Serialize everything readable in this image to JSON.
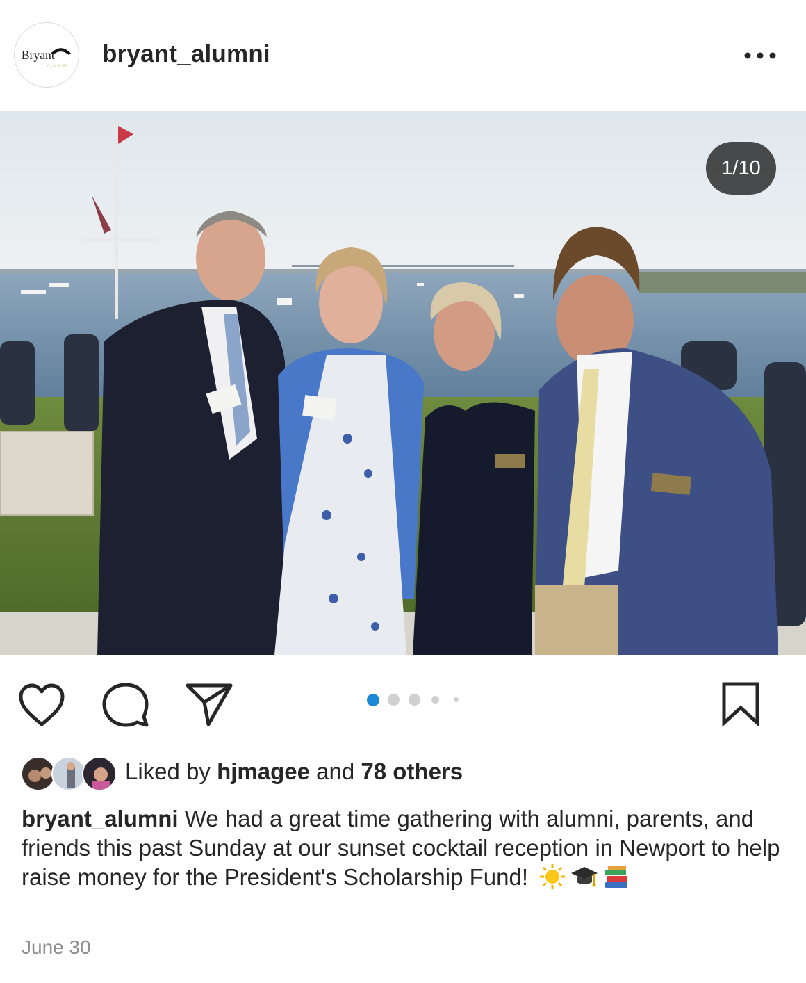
{
  "post": {
    "username": "bryant_alumni",
    "avatar_logo_text": "Bryant",
    "avatar_logo_subtext": "ALUMNI",
    "counter": "1/10",
    "carousel": {
      "current": 1,
      "total": 10
    },
    "likes": {
      "prefix": "Liked by ",
      "user": "hjmagee",
      "middle": " and ",
      "others": "78 others"
    },
    "caption": {
      "username": "bryant_alumni",
      "text": " We had a great time gathering with alumni, parents, and friends this past Sunday at our sunset cocktail reception in Newport to help raise money for the President's Scholarship Fund!",
      "emojis": [
        "sun-emoji",
        "graduation-cap-emoji",
        "books-emoji"
      ]
    },
    "date": "June 30"
  },
  "icons": {
    "more": "more-options-icon",
    "like": "heart-icon",
    "comment": "comment-icon",
    "share": "paper-plane-icon",
    "save": "bookmark-icon"
  },
  "colors": {
    "text": "#262626",
    "muted": "#8e8e8e",
    "active_dot": "#1a8ad8",
    "inactive_dot": "#d0d0d0"
  }
}
